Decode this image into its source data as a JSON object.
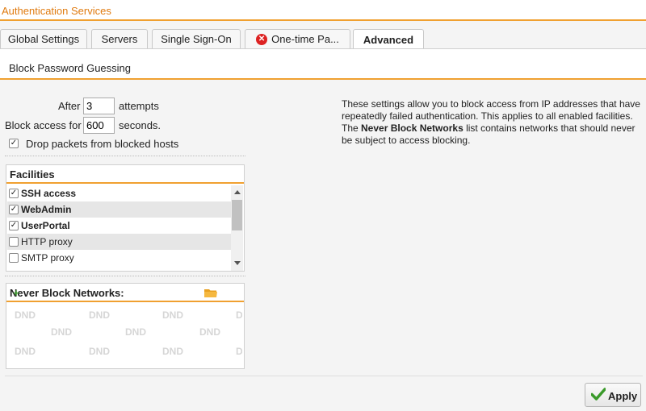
{
  "window": {
    "title": "Authentication Services"
  },
  "tabs": [
    {
      "label": "Global Settings"
    },
    {
      "label": "Servers"
    },
    {
      "label": "Single Sign-On"
    },
    {
      "label": "One-time Pa...",
      "error_icon": "error-x-icon"
    },
    {
      "label": "Advanced",
      "active": true
    }
  ],
  "section": {
    "title": "Block Password Guessing"
  },
  "settings": {
    "after_label": "After",
    "attempts_value": "3",
    "attempts_label": "attempts",
    "block_label": "Block access for",
    "seconds_value": "600",
    "seconds_label": "seconds.",
    "drop_label": "Drop packets from blocked hosts",
    "drop_checked": true
  },
  "facilities": {
    "title": "Facilities",
    "items": [
      {
        "label": "SSH access",
        "checked": true
      },
      {
        "label": "WebAdmin",
        "checked": true
      },
      {
        "label": "UserPortal",
        "checked": true
      },
      {
        "label": "HTTP proxy",
        "checked": false
      },
      {
        "label": "SMTP proxy",
        "checked": false
      }
    ]
  },
  "never_block": {
    "title": "Never Block Networks:",
    "icons": [
      "folder-icon",
      "plus-icon"
    ],
    "dnd_text": "DND"
  },
  "info": {
    "text1": "These settings allow you to block access from IP addresses that have repeatedly failed authentication. This applies to all enabled facilities. The ",
    "bold": "Never Block Networks",
    "text2": " list contains networks that should never be subject to access blocking."
  },
  "apply": {
    "label": "Apply"
  },
  "colors": {
    "accent": "#f0a030",
    "title": "#e07b10",
    "apply_check": "#3a9a2a",
    "error": "#d22222"
  }
}
